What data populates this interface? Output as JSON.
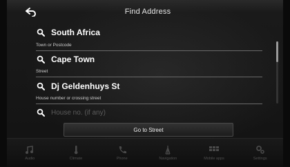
{
  "header": {
    "title": "Find Address"
  },
  "fields": [
    {
      "value": "South Africa",
      "label": "Town or Postcode"
    },
    {
      "value": "Cape Town",
      "label": "Street"
    },
    {
      "value": "Dj Geldenhuys St",
      "label": "House number or crossing street"
    },
    {
      "value": "House no. (if any)"
    }
  ],
  "actions": {
    "go_label": "Go to Street"
  },
  "tabs": [
    {
      "label": "Audio",
      "icon": "music-note-icon"
    },
    {
      "label": "Climate",
      "icon": "climate-icon"
    },
    {
      "label": "Phone",
      "icon": "phone-icon"
    },
    {
      "label": "Navigation",
      "icon": "navigation-icon"
    },
    {
      "label": "Mobile apps",
      "icon": "apps-grid-icon"
    },
    {
      "label": "Settings",
      "icon": "settings-icon"
    }
  ]
}
